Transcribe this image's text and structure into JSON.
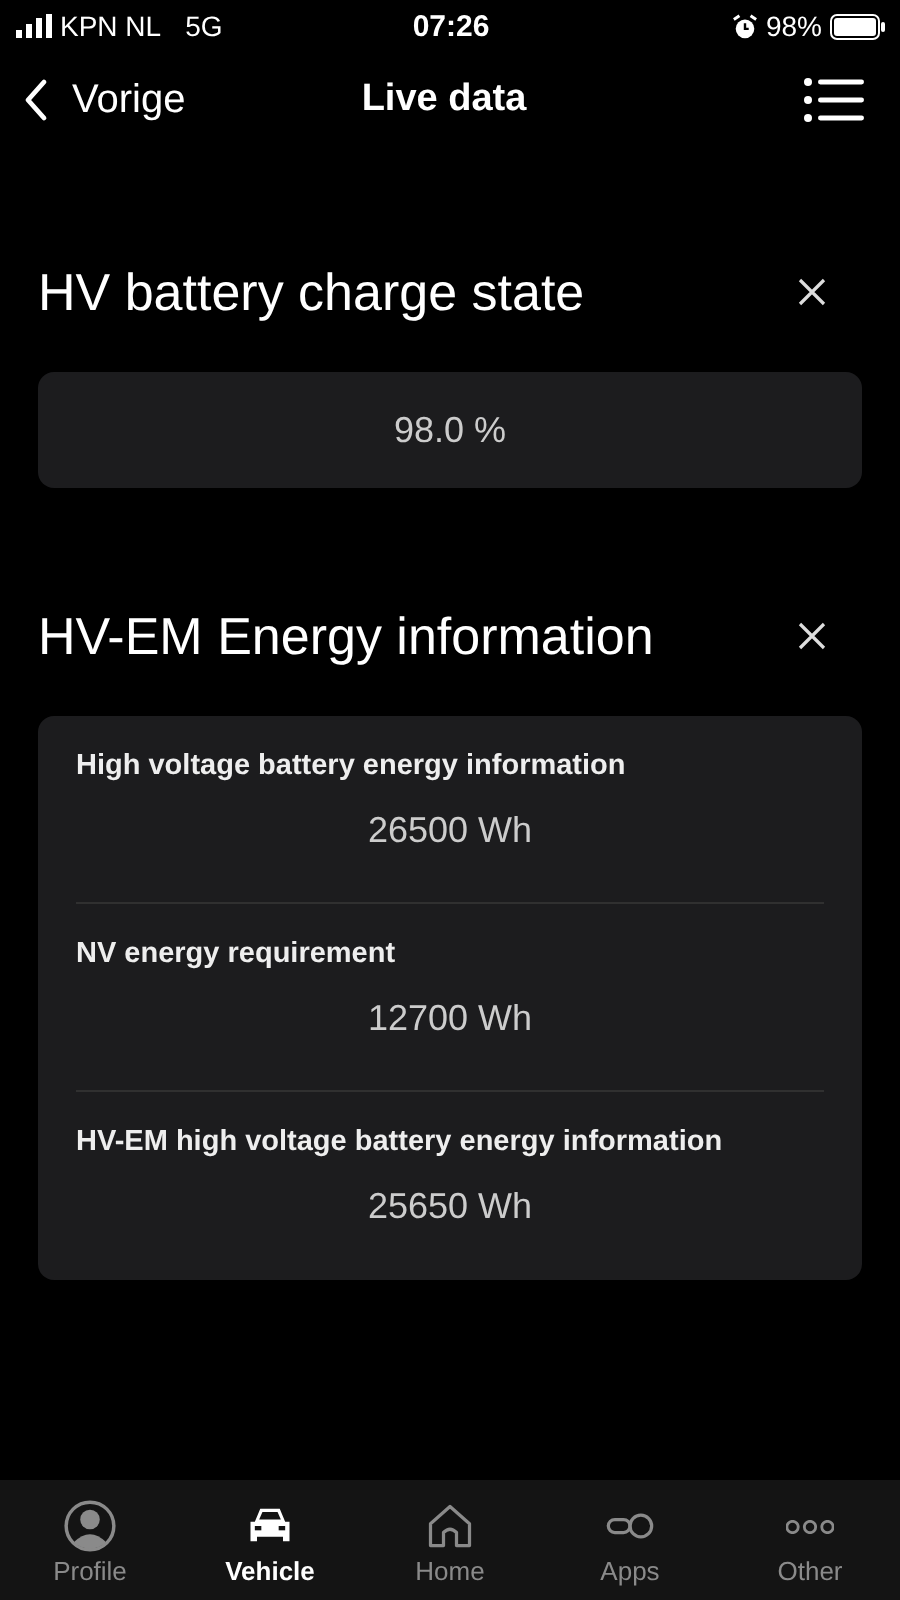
{
  "status_bar": {
    "carrier": "KPN NL",
    "network": "5G",
    "time": "07:26",
    "battery": "98%"
  },
  "nav": {
    "back": "Vorige",
    "title": "Live data"
  },
  "sections": [
    {
      "title": "HV battery charge state",
      "items": [
        {
          "value": "98.0 %"
        }
      ]
    },
    {
      "title": "HV-EM Energy information",
      "items": [
        {
          "label": "High voltage battery energy information",
          "value": "26500 Wh"
        },
        {
          "label": "NV energy requirement",
          "value": "12700 Wh"
        },
        {
          "label": "HV-EM high voltage battery energy information",
          "value": "25650 Wh"
        }
      ]
    }
  ],
  "tabs": [
    {
      "kind": "profile",
      "label": "Profile",
      "selected": false
    },
    {
      "kind": "vehicle",
      "label": "Vehicle",
      "selected": true
    },
    {
      "kind": "home",
      "label": "Home",
      "selected": false
    },
    {
      "kind": "apps",
      "label": "Apps",
      "selected": false
    },
    {
      "kind": "other",
      "label": "Other",
      "selected": false
    }
  ]
}
